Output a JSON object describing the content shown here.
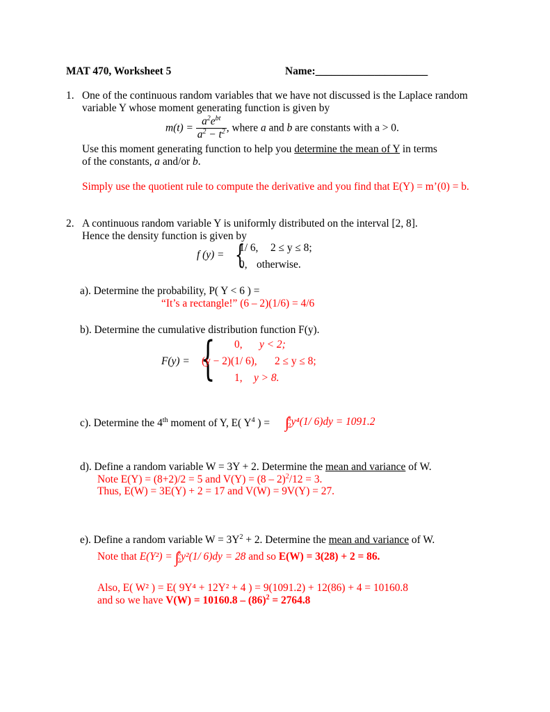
{
  "header": {
    "title": "MAT 470, Worksheet 5",
    "name_label": "Name:",
    "name_blank": "_____________________"
  },
  "q1": {
    "number": "1.",
    "line1": "One of the continuous random variables that we have not discussed is the Laplace random",
    "line2": "variable Y whose moment generating function is given by",
    "formula_lhs": "m(t) =",
    "formula_num": "a²e^{bt}",
    "formula_den": "a² − t²",
    "formula_tail_pre": ",  where ",
    "formula_a": "a",
    "formula_and": " and ",
    "formula_b": "b",
    "formula_tail_post": " are constants with a > 0.",
    "instr_pre": "Use this moment generating function to help you ",
    "instr_underlined": "determine the mean of Y",
    "instr_post": " in terms",
    "instr_line2_pre": "of the constants, ",
    "instr_line2_a": "a",
    "instr_line2_mid": " and/or ",
    "instr_line2_b": "b",
    "instr_line2_end": ".",
    "answer": "Simply use the quotient rule to compute the derivative and you find that E(Y) = m’(0) = b."
  },
  "q2": {
    "number": "2.",
    "line1": "A continuous random variable Y is uniformly distributed on the interval [2, 8].",
    "line2": "Hence the density function is given by",
    "density_lhs": "f (y) =",
    "density_case1_val": "1/ 6,",
    "density_case1_cond": "2 ≤ y ≤ 8;",
    "density_case2_val": "0,",
    "density_case2_cond": "otherwise.",
    "a": {
      "question": "a).  Determine the probability, P( Y < 6 ) =",
      "answer": "“It’s a rectangle!”  (6 – 2)(1/6) = 4/6"
    },
    "b": {
      "question": "b).  Determine the cumulative distribution function F(y).",
      "cdf_lhs": "F(y) =",
      "cases": [
        {
          "val": "0,",
          "cond": "y < 2;"
        },
        {
          "val": "(y − 2)(1/ 6),",
          "cond": "2 ≤ y ≤ 8;"
        },
        {
          "val": "1,",
          "cond": "y > 8."
        }
      ]
    },
    "c": {
      "question_pre": "c).  Determine the 4",
      "question_sup": "th",
      "question_post": "  moment of Y, E( Y",
      "question_post_sup": "4",
      "question_end": " ) =",
      "integral_upper": "8",
      "integral_lower": "2",
      "answer": "y⁴(1/ 6)dy = 1091.2"
    },
    "d": {
      "question_pre": "d).  Define a random variable W = 3Y + 2.  Determine the ",
      "question_underlined": "mean and variance",
      "question_post": " of W.",
      "answer1_pre": "Note E(Y) = (8+2)/2 = 5 and V(Y) = (8 – 2)",
      "answer1_sup": "2",
      "answer1_post": "/12 = 3.",
      "answer2": "Thus, E(W) = 3E(Y) + 2 = 17 and V(W) = 9V(Y) = 27."
    },
    "e": {
      "question_pre": "e).  Define a random variable W = 3Y",
      "question_sup": "2",
      "question_mid": " + 2.  Determine the ",
      "question_underlined": "mean and variance",
      "question_post": " of W.",
      "answer1_pre": "Note that ",
      "answer1_formula": "E(Y²) =",
      "integral_upper": "8",
      "integral_lower": "2",
      "answer1_integrand": "y²(1/ 6)dy = 28",
      "answer1_mid": " and so ",
      "answer1_bold": "E(W) = 3(28) + 2 = 86.",
      "answer2": "Also, E( W² ) = E( 9Y⁴ + 12Y² + 4 ) = 9(1091.2) + 12(86) + 4 = 10160.8",
      "answer3_pre": "and so we have ",
      "answer3_bold_pre": "V(W) = 10160.8 – (86)",
      "answer3_bold_sup": "2",
      "answer3_bold_post": " = 2764.8"
    }
  }
}
